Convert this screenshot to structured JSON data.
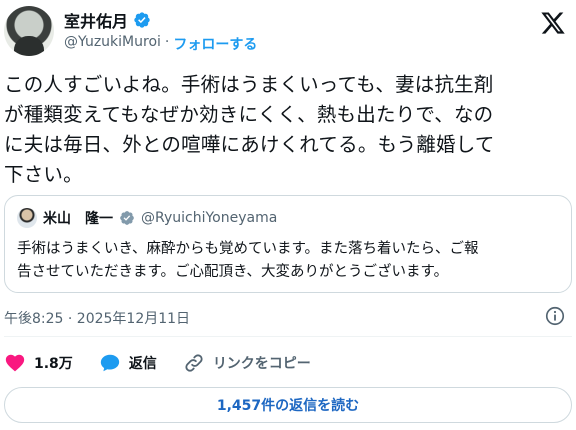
{
  "author": {
    "display_name": "室井佑月",
    "handle": "@YuzukiMuroi",
    "separator": "·",
    "follow_label": "フォローする"
  },
  "tweet": {
    "text_lines": [
      "この人すごいよね。手術はうまくいっても、妻は抗生剤",
      "が種類変えてもなぜか効きにくく、熱も出たりで、なの",
      "に夫は毎日、外との喧嘩にあけくれてる。もう離婚して",
      "下さい。"
    ],
    "timestamp": "午後8:25 · 2025年12月11日"
  },
  "quoted_tweet": {
    "display_name": "米山　隆一",
    "handle": "@RyuichiYoneyama",
    "text_lines": [
      "手術はうまくいき、麻酔からも覚めています。また落ち着いたら、ご報",
      "告させていただきます。ご心配頂き、大変ありがとうございます。"
    ]
  },
  "actions": {
    "like_count": "1.8万",
    "reply_label": "返信",
    "copy_link_label": "リンクをコピー"
  },
  "read_replies_label": "1,457件の返信を読む",
  "colors": {
    "accent": "#1d9bf0",
    "like": "#f91880",
    "text": "#0f1419",
    "muted": "#536471"
  },
  "icons": {
    "verified": "verified-badge-icon",
    "brand": "x-logo-icon",
    "info": "info-icon",
    "like": "heart-icon",
    "reply": "speech-bubble-icon",
    "copy_link": "link-icon"
  }
}
